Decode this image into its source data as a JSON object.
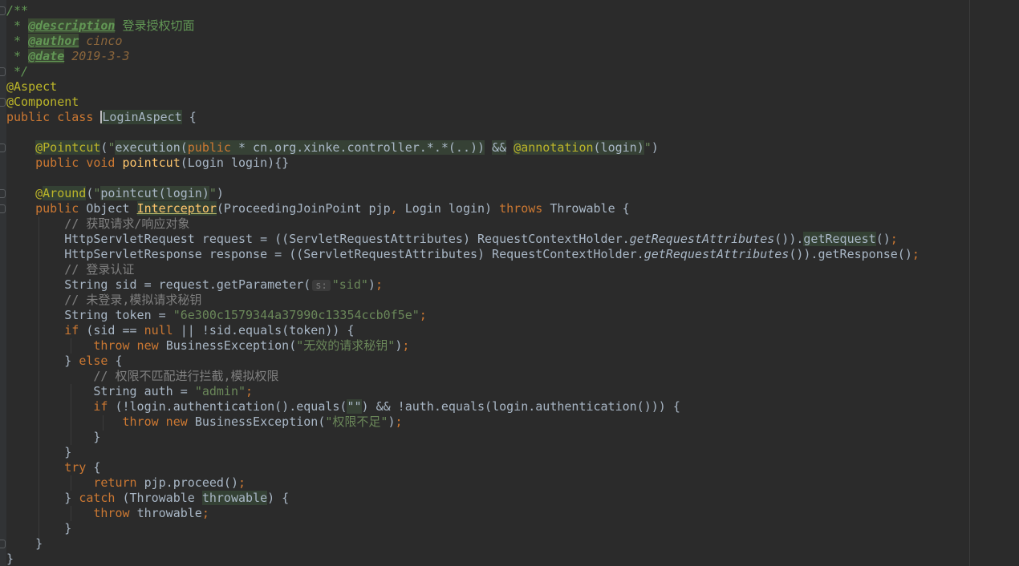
{
  "editor": {
    "lines": [
      [
        [
          "t-doc",
          "/**"
        ]
      ],
      [
        [
          "t-doc",
          " * "
        ],
        [
          "t-tag",
          "@description"
        ],
        [
          "t-cn-doc",
          " 登录授权切面"
        ]
      ],
      [
        [
          "t-doc",
          " * "
        ],
        [
          "t-tag",
          "@author"
        ],
        [
          "t-tagtext",
          " cinco"
        ]
      ],
      [
        [
          "t-doc",
          " * "
        ],
        [
          "t-tag",
          "@date"
        ],
        [
          "t-tagtext",
          " 2019-3-3"
        ]
      ],
      [
        [
          "t-doc",
          " */"
        ]
      ],
      [
        [
          "t-ann",
          "@Aspect"
        ]
      ],
      [
        [
          "t-ann",
          "@Component"
        ]
      ],
      [
        [
          "t-kw",
          "public class "
        ],
        [
          "t-cls",
          "LoginAspect"
        ],
        [
          "t-txt",
          " {"
        ]
      ],
      [],
      [
        [
          "t-txt",
          "    "
        ],
        [
          "t-ann-hl",
          "@Pointcut"
        ],
        [
          "t-txt",
          "("
        ],
        [
          "t-str",
          "\""
        ],
        [
          "t-str-inj",
          "execution("
        ],
        [
          "t-str-inj-kw",
          "public"
        ],
        [
          "t-str-inj",
          " * cn.org.xinke.controller.*.*(..))"
        ],
        [
          "t-txt",
          " "
        ],
        [
          "t-str-inj",
          "&&"
        ],
        [
          "t-txt",
          " "
        ],
        [
          "t-str-inj-ann",
          "@annotation"
        ],
        [
          "t-str-inj",
          "(login)"
        ],
        [
          "t-str",
          "\""
        ],
        [
          "t-txt",
          ")"
        ]
      ],
      [
        [
          "t-txt",
          "    "
        ],
        [
          "t-kw",
          "public void "
        ],
        [
          "t-fn",
          "pointcut"
        ],
        [
          "t-txt",
          "(Login login){}"
        ]
      ],
      [],
      [
        [
          "t-txt",
          "    "
        ],
        [
          "t-ann",
          "@"
        ],
        [
          "t-ann-hl",
          "Around"
        ],
        [
          "t-txt",
          "("
        ],
        [
          "t-str",
          "\""
        ],
        [
          "t-str-inj",
          "pointcut(login)"
        ],
        [
          "t-str",
          "\""
        ],
        [
          "t-txt",
          ")"
        ]
      ],
      [
        [
          "t-txt",
          "    "
        ],
        [
          "t-kw",
          "public "
        ],
        [
          "t-txt",
          "Object "
        ],
        [
          "t-fn-hl",
          "Interceptor"
        ],
        [
          "t-txt",
          "(ProceedingJoinPoint pjp"
        ],
        [
          "t-punc",
          ", "
        ],
        [
          "t-txt",
          "Login login) "
        ],
        [
          "t-kw",
          "throws "
        ],
        [
          "t-txt",
          "Throwable {"
        ]
      ],
      [
        [
          "t-txt",
          "        "
        ],
        [
          "t-cmt",
          "// 获取请求/响应对象"
        ]
      ],
      [
        [
          "t-txt",
          "        HttpServletRequest request = ((ServletRequestAttributes) RequestContextHolder."
        ],
        [
          "t-static",
          "getRequestAttributes"
        ],
        [
          "t-txt",
          "())."
        ],
        [
          "t-var-hl",
          "getRequest"
        ],
        [
          "t-txt",
          "()"
        ],
        [
          "t-punc",
          ";"
        ]
      ],
      [
        [
          "t-txt",
          "        HttpServletResponse response = ((ServletRequestAttributes) RequestContextHolder."
        ],
        [
          "t-static",
          "getRequestAttributes"
        ],
        [
          "t-txt",
          "()).getResponse()"
        ],
        [
          "t-punc",
          ";"
        ]
      ],
      [
        [
          "t-txt",
          "        "
        ],
        [
          "t-cmt",
          "// 登录认证"
        ]
      ],
      [
        [
          "t-txt",
          "        String sid = request.getParameter("
        ],
        [
          "t-param",
          "s:"
        ],
        [
          "t-str",
          "\"sid\""
        ],
        [
          "t-txt",
          ")"
        ],
        [
          "t-punc",
          ";"
        ]
      ],
      [
        [
          "t-txt",
          "        "
        ],
        [
          "t-cmt",
          "// 未登录,模拟请求秘钥"
        ]
      ],
      [
        [
          "t-txt",
          "        String token = "
        ],
        [
          "t-str",
          "\"6e300c1579344a37990c13354ccb0f5e\""
        ],
        [
          "t-punc",
          ";"
        ]
      ],
      [
        [
          "t-txt",
          "        "
        ],
        [
          "t-kw",
          "if "
        ],
        [
          "t-txt",
          "(sid == "
        ],
        [
          "t-kw",
          "null "
        ],
        [
          "t-txt",
          "|| !sid.equals(token)) {"
        ]
      ],
      [
        [
          "t-txt",
          "            "
        ],
        [
          "t-kw",
          "throw new "
        ],
        [
          "t-txt",
          "BusinessException("
        ],
        [
          "t-str",
          "\"无效的请求秘钥\""
        ],
        [
          "t-txt",
          ")"
        ],
        [
          "t-punc",
          ";"
        ]
      ],
      [
        [
          "t-txt",
          "        } "
        ],
        [
          "t-kw",
          "else "
        ],
        [
          "t-txt",
          "{"
        ]
      ],
      [
        [
          "t-txt",
          "            "
        ],
        [
          "t-cmt",
          "// 权限不匹配进行拦截,模拟权限"
        ]
      ],
      [
        [
          "t-txt",
          "            String auth = "
        ],
        [
          "t-str",
          "\"admin\""
        ],
        [
          "t-punc",
          ";"
        ]
      ],
      [
        [
          "t-txt",
          "            "
        ],
        [
          "t-kw",
          "if "
        ],
        [
          "t-txt",
          "(!login.authentication().equals("
        ],
        [
          "t-str-inj",
          "\"\""
        ],
        [
          "t-txt",
          ") && !auth.equals(login.authentication())) {"
        ]
      ],
      [
        [
          "t-txt",
          "                "
        ],
        [
          "t-kw",
          "throw new "
        ],
        [
          "t-txt",
          "BusinessException("
        ],
        [
          "t-str",
          "\"权限不足\""
        ],
        [
          "t-txt",
          ")"
        ],
        [
          "t-punc",
          ";"
        ]
      ],
      [
        [
          "t-txt",
          "            }"
        ]
      ],
      [
        [
          "t-txt",
          "        }"
        ]
      ],
      [
        [
          "t-txt",
          "        "
        ],
        [
          "t-kw",
          "try "
        ],
        [
          "t-txt",
          "{"
        ]
      ],
      [
        [
          "t-txt",
          "            "
        ],
        [
          "t-kw",
          "return "
        ],
        [
          "t-txt",
          "pjp.proceed()"
        ],
        [
          "t-punc",
          ";"
        ]
      ],
      [
        [
          "t-txt",
          "        } "
        ],
        [
          "t-kw",
          "catch "
        ],
        [
          "t-txt",
          "(Throwable "
        ],
        [
          "t-var-hl",
          "throwable"
        ],
        [
          "t-txt",
          ") {"
        ]
      ],
      [
        [
          "t-txt",
          "            "
        ],
        [
          "t-kw",
          "throw "
        ],
        [
          "t-txt",
          "throwable"
        ],
        [
          "t-punc",
          ";"
        ]
      ],
      [
        [
          "t-txt",
          "        }"
        ]
      ],
      [
        [
          "t-txt",
          "    }"
        ]
      ],
      [
        [
          "t-txt",
          "}"
        ]
      ]
    ]
  }
}
